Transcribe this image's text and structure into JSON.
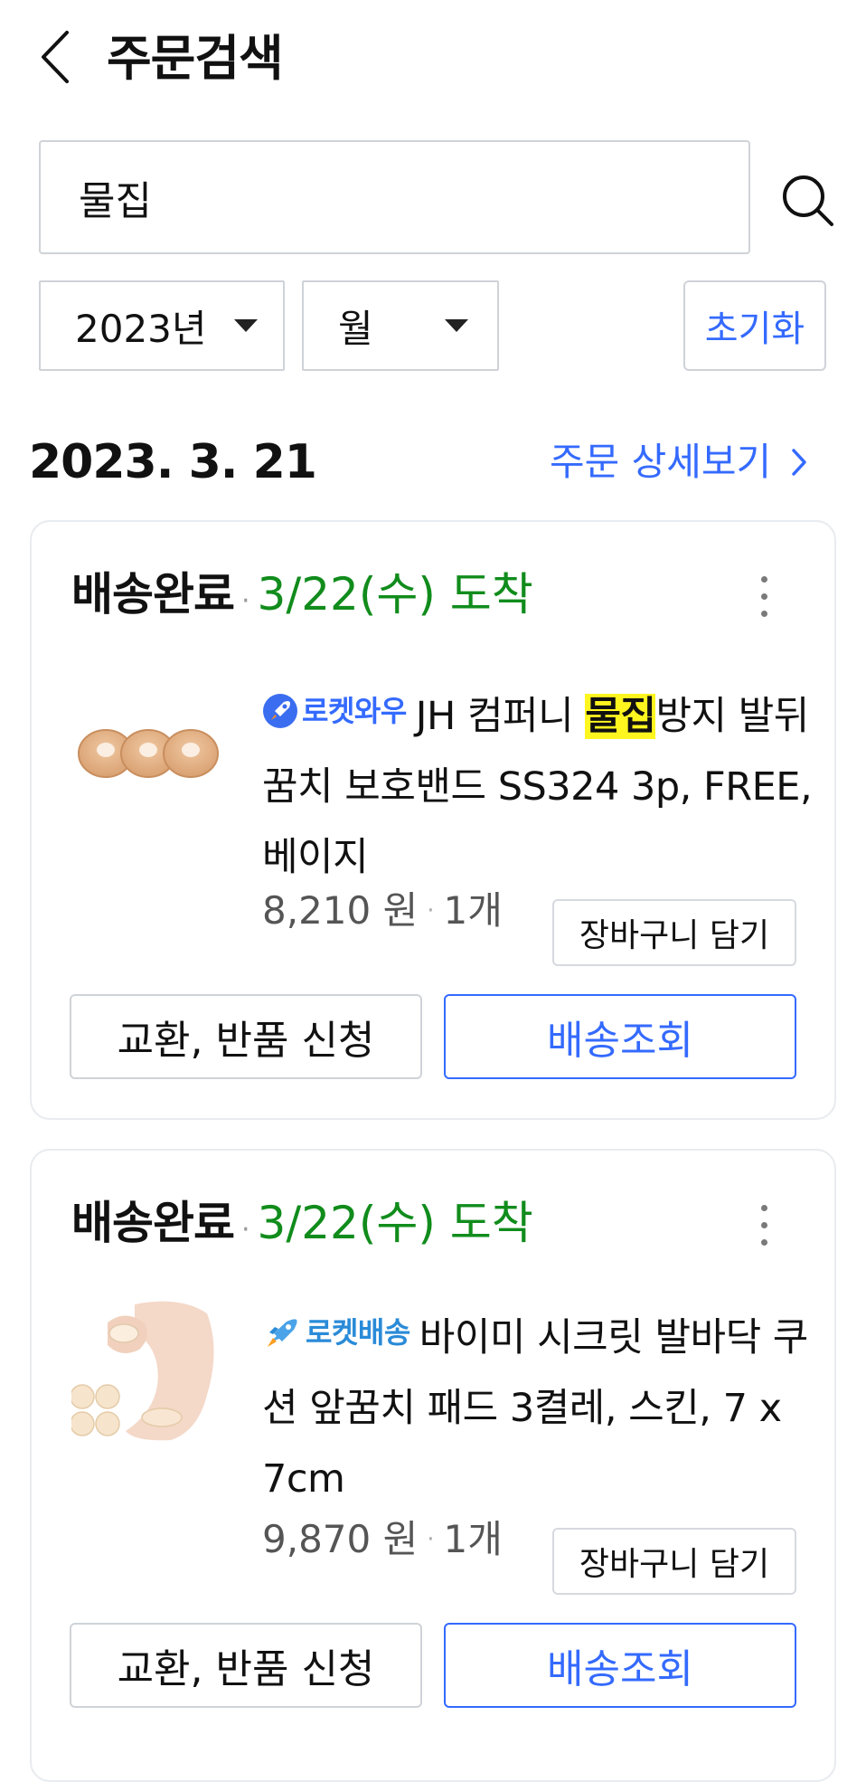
{
  "header": {
    "title": "주문검색",
    "back_icon": "chevron-left-icon"
  },
  "search": {
    "value": "물집",
    "placeholder": "",
    "search_icon": "search-icon"
  },
  "filters": {
    "year": "2023년",
    "month": "월",
    "reset_label": "초기화"
  },
  "order_group": {
    "date": "2023. 3. 21",
    "detail_label": "주문 상세보기"
  },
  "orders": [
    {
      "status": "배송완료",
      "arrival": "3/22(수) 도착",
      "badge": "로켓와우",
      "name_prefix": "JH 컴퍼니 ",
      "name_highlight": "물집",
      "name_suffix": "방지 발뒤꿈치 보호밴드 SS324 3p, FREE, 베이지",
      "price": "8,210 원",
      "quantity": "1개",
      "cart_label": "장바구니 담기",
      "return_label": "교환, 반품 신청",
      "track_label": "배송조회"
    },
    {
      "status": "배송완료",
      "arrival": "3/22(수) 도착",
      "badge": "로켓배송",
      "name_prefix": "바이미 시크릿 발바닥 쿠션 앞꿈치 패드 3켤레, 스킨, 7 x 7cm",
      "name_highlight": "",
      "name_suffix": "",
      "price": "9,870 원",
      "quantity": "1개",
      "cart_label": "장바구니 담기",
      "return_label": "교환, 반품 신청",
      "track_label": "배송조회"
    }
  ],
  "colors": {
    "accent": "#346aff",
    "arrival": "#118c1c",
    "highlight": "#fff51f"
  }
}
